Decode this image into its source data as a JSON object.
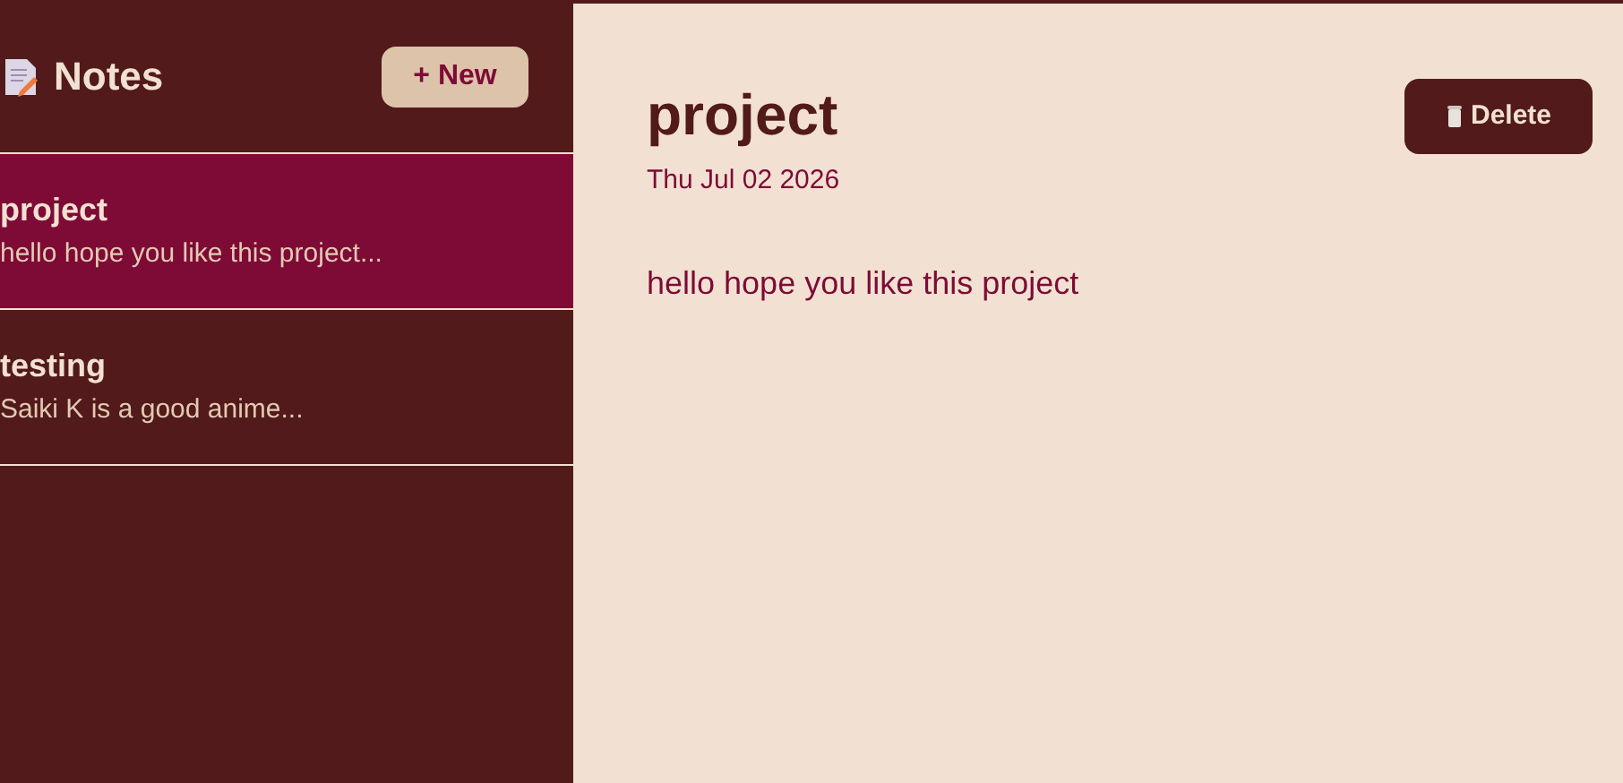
{
  "sidebar": {
    "title": "Notes",
    "new_button": "+ New",
    "notes": [
      {
        "title": "project",
        "preview": "hello hope you like this project...",
        "selected": true
      },
      {
        "title": "testing",
        "preview": "Saiki K is a good anime...",
        "selected": false
      }
    ]
  },
  "editor": {
    "title": "project",
    "date": "Thu Jul 02 2026",
    "body": "hello hope you like this project",
    "delete_button": "Delete"
  }
}
